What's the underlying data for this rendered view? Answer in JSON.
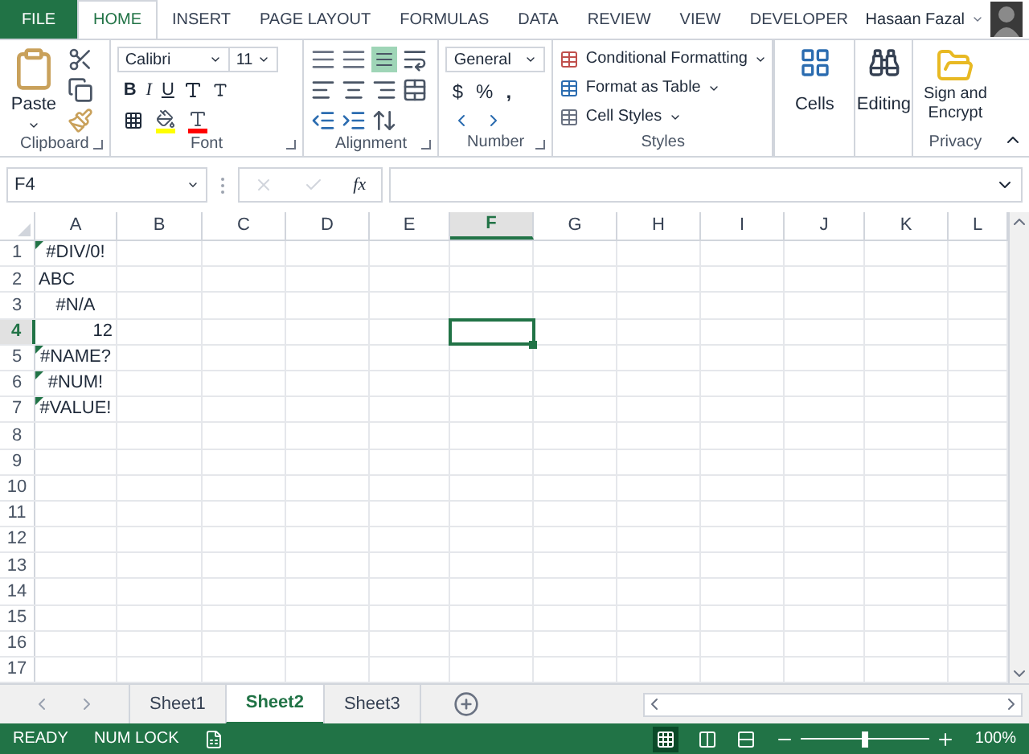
{
  "tabs": [
    {
      "label": "FILE",
      "kind": "file",
      "selected": false
    },
    {
      "label": "HOME",
      "kind": "tab",
      "selected": true
    },
    {
      "label": "INSERT",
      "kind": "tab",
      "selected": false
    },
    {
      "label": "PAGE LAYOUT",
      "kind": "tab",
      "selected": false
    },
    {
      "label": "FORMULAS",
      "kind": "tab",
      "selected": false
    },
    {
      "label": "DATA",
      "kind": "tab",
      "selected": false
    },
    {
      "label": "REVIEW",
      "kind": "tab",
      "selected": false
    },
    {
      "label": "VIEW",
      "kind": "tab",
      "selected": false
    },
    {
      "label": "DEVELOPER",
      "kind": "tab",
      "selected": false
    }
  ],
  "user": {
    "name": "Hasaan Fazal"
  },
  "ribbon": {
    "clipboard": {
      "label": "Clipboard",
      "paste": "Paste"
    },
    "font": {
      "label": "Font",
      "family": "Calibri",
      "size": "11",
      "bold": "B",
      "italic": "I",
      "underline": "U"
    },
    "alignment": {
      "label": "Alignment"
    },
    "number": {
      "label": "Number",
      "format": "General",
      "currency": "$",
      "percent": "%",
      "comma": ","
    },
    "styles": {
      "label": "Styles",
      "items": [
        "Conditional Formatting",
        "Format as Table",
        "Cell Styles"
      ]
    },
    "cells": {
      "label": "Cells"
    },
    "editing": {
      "label": "Editing"
    },
    "privacy": {
      "label": "Privacy",
      "button": "Sign and Encrypt"
    }
  },
  "formula_bar": {
    "name_box": "F4",
    "fx": "fx"
  },
  "columns": [
    {
      "label": "A",
      "selected": false
    },
    {
      "label": "B",
      "selected": false
    },
    {
      "label": "C",
      "selected": false
    },
    {
      "label": "D",
      "selected": false
    },
    {
      "label": "E",
      "selected": false
    },
    {
      "label": "F",
      "selected": true
    },
    {
      "label": "G",
      "selected": false
    },
    {
      "label": "H",
      "selected": false
    },
    {
      "label": "I",
      "selected": false
    },
    {
      "label": "J",
      "selected": false
    },
    {
      "label": "K",
      "selected": false
    },
    {
      "label": "L",
      "selected": false
    }
  ],
  "rows": [
    {
      "label": "1",
      "selected": false,
      "cells": [
        {
          "text": "#DIV/0!",
          "kind": "error",
          "error_flag": true
        }
      ]
    },
    {
      "label": "2",
      "selected": false,
      "cells": [
        {
          "text": "ABC",
          "kind": "text",
          "error_flag": false
        }
      ]
    },
    {
      "label": "3",
      "selected": false,
      "cells": [
        {
          "text": "#N/A",
          "kind": "error",
          "error_flag": false
        }
      ]
    },
    {
      "label": "4",
      "selected": true,
      "cells": [
        {
          "text": "12",
          "kind": "number",
          "error_flag": false
        }
      ]
    },
    {
      "label": "5",
      "selected": false,
      "cells": [
        {
          "text": "#NAME?",
          "kind": "error",
          "error_flag": true
        }
      ]
    },
    {
      "label": "6",
      "selected": false,
      "cells": [
        {
          "text": "#NUM!",
          "kind": "error",
          "error_flag": true
        }
      ]
    },
    {
      "label": "7",
      "selected": false,
      "cells": [
        {
          "text": "#VALUE!",
          "kind": "error",
          "error_flag": true
        }
      ]
    },
    {
      "label": "8",
      "selected": false,
      "cells": []
    },
    {
      "label": "9",
      "selected": false,
      "cells": []
    },
    {
      "label": "10",
      "selected": false,
      "cells": []
    },
    {
      "label": "11",
      "selected": false,
      "cells": []
    },
    {
      "label": "12",
      "selected": false,
      "cells": []
    },
    {
      "label": "13",
      "selected": false,
      "cells": []
    },
    {
      "label": "14",
      "selected": false,
      "cells": []
    },
    {
      "label": "15",
      "selected": false,
      "cells": []
    },
    {
      "label": "16",
      "selected": false,
      "cells": []
    },
    {
      "label": "17",
      "selected": false,
      "cells": []
    }
  ],
  "sheets": [
    {
      "label": "Sheet1",
      "selected": false
    },
    {
      "label": "Sheet2",
      "selected": true
    },
    {
      "label": "Sheet3",
      "selected": false
    }
  ],
  "status_bar": {
    "mode": "READY",
    "num_lock": "NUM LOCK",
    "zoom": {
      "level": 0.5,
      "reading": "100%"
    }
  }
}
